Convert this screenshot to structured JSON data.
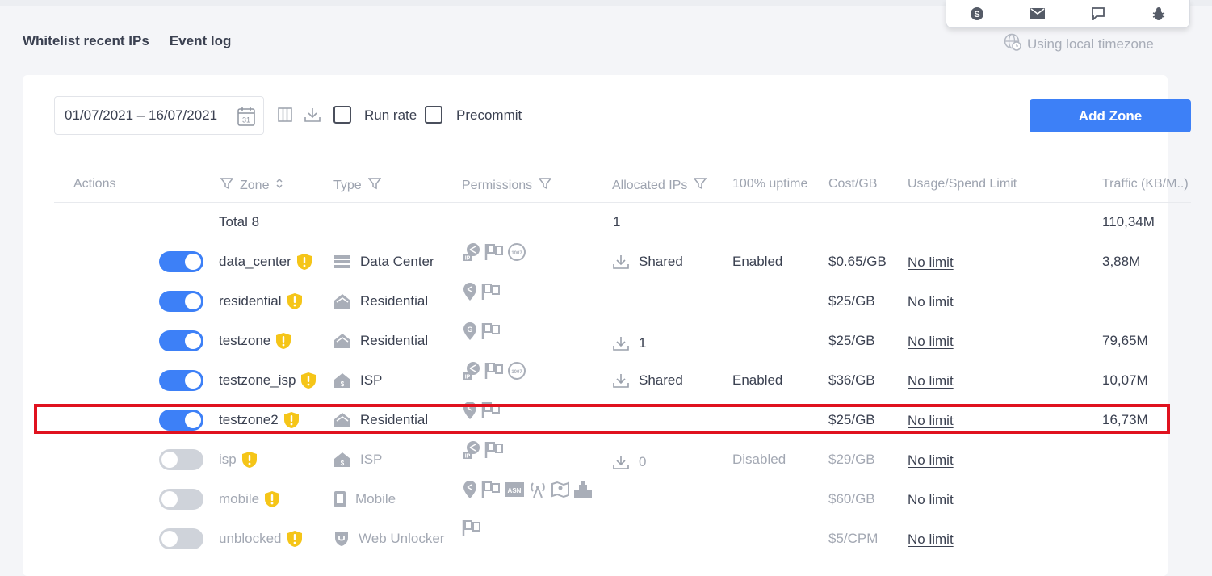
{
  "nav": {
    "whitelist_label": "Whitelist recent IPs",
    "event_log_label": "Event log"
  },
  "support_icons": [
    "skype-icon",
    "mail-icon",
    "chat-icon",
    "bug-icon"
  ],
  "timezone": {
    "label": "Using local timezone",
    "icon": "globe-clock-icon"
  },
  "toolbar": {
    "date_range": "01/07/2021 – 16/07/2021",
    "calendar_day": "31",
    "run_rate_label": "Run rate",
    "run_rate_checked": false,
    "precommit_label": "Precommit",
    "precommit_checked": false,
    "add_zone_label": "Add Zone"
  },
  "colors": {
    "accent": "#3d80f7",
    "warning": "#f5c518",
    "highlight": "#e0121f"
  },
  "table": {
    "headers": {
      "actions": "Actions",
      "zone": "Zone",
      "type": "Type",
      "permissions": "Permissions",
      "allocated_ips": "Allocated IPs",
      "uptime": "100% uptime",
      "cost": "Cost/GB",
      "usage": "Usage/Spend Limit",
      "traffic": "Traffic (KB/M..)"
    },
    "total": {
      "label": "Total 8",
      "allocated": "1",
      "traffic": "110,34M"
    },
    "rows": [
      {
        "enabled": true,
        "zone": "data_center",
        "type": "Data Center",
        "type_icon": "server-icon",
        "permissions": [
          "ip-geo-icon",
          "flag-icon",
          "asn-icon"
        ],
        "allocated": "Shared",
        "uptime": "Enabled",
        "cost": "$0.65/GB",
        "limit": "No limit",
        "traffic": "3,88M"
      },
      {
        "enabled": true,
        "zone": "residential",
        "type": "Residential",
        "type_icon": "house-icon",
        "permissions": [
          "location-pin-icon",
          "flag-icon"
        ],
        "allocated": "",
        "uptime": "",
        "cost": "$25/GB",
        "limit": "No limit",
        "traffic": ""
      },
      {
        "enabled": true,
        "zone": "testzone",
        "type": "Residential",
        "type_icon": "house-icon",
        "permissions": [
          "location-g-icon",
          "flag-icon"
        ],
        "allocated": "1",
        "uptime": "",
        "cost": "$25/GB",
        "limit": "No limit",
        "traffic": "79,65M"
      },
      {
        "enabled": true,
        "zone": "testzone_isp",
        "type": "ISP",
        "type_icon": "isp-house-icon",
        "permissions": [
          "ip-geo-icon",
          "flag-icon",
          "asn-icon"
        ],
        "allocated": "Shared",
        "uptime": "Enabled",
        "cost": "$36/GB",
        "limit": "No limit",
        "traffic": "10,07M"
      },
      {
        "enabled": true,
        "zone": "testzone2",
        "type": "Residential",
        "type_icon": "house-icon",
        "permissions": [
          "location-pin-icon",
          "flag-icon"
        ],
        "allocated": "",
        "uptime": "",
        "cost": "$25/GB",
        "limit": "No limit",
        "traffic": "16,73M"
      },
      {
        "enabled": false,
        "zone": "isp",
        "type": "ISP",
        "type_icon": "isp-house-icon",
        "permissions": [
          "ip-geo-icon",
          "flag-icon"
        ],
        "allocated": "0",
        "uptime": "Disabled",
        "cost": "$29/GB",
        "limit": "No limit",
        "traffic": ""
      },
      {
        "enabled": false,
        "zone": "mobile",
        "type": "Mobile",
        "type_icon": "phone-icon",
        "permissions": [
          "location-pin-icon",
          "flag-icon",
          "asn-icon",
          "antenna-icon",
          "map-icon",
          "carrier-icon"
        ],
        "allocated": "",
        "uptime": "",
        "cost": "$60/GB",
        "limit": "No limit",
        "traffic": ""
      },
      {
        "enabled": false,
        "zone": "unblocked",
        "type": "Web Unlocker",
        "type_icon": "shield-unlock-icon",
        "permissions": [
          "flag-icon"
        ],
        "allocated": "",
        "uptime": "",
        "cost": "$5/CPM",
        "limit": "No limit",
        "traffic": ""
      }
    ]
  }
}
